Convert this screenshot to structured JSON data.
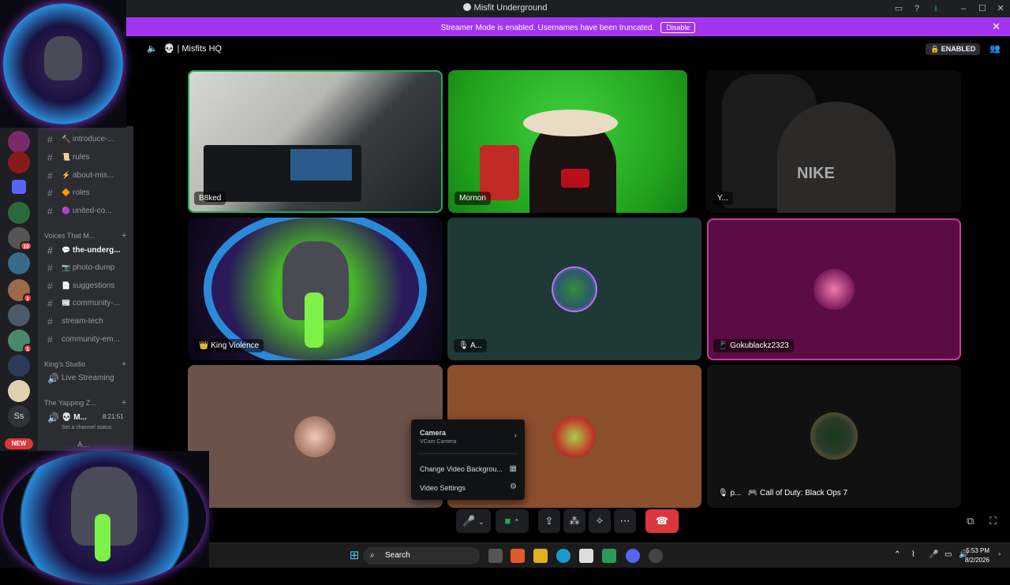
{
  "window": {
    "title": "Misfit Underground"
  },
  "banner": {
    "text": "Streamer Mode is enabled. Usernames have been truncated.",
    "button": "Disable"
  },
  "header": {
    "channel": "Misfits HQ",
    "status": "ENABLED"
  },
  "channels": [
    {
      "emoji": "🔨",
      "label": "introduce-..."
    },
    {
      "emoji": "📜",
      "label": "rules"
    },
    {
      "emoji": "⚡",
      "label": "about-mis..."
    },
    {
      "emoji": "🔶",
      "label": "roles"
    },
    {
      "emoji": "🟣",
      "label": "united-co..."
    }
  ],
  "category1": "Voices That M...",
  "channels2": [
    {
      "emoji": "💬",
      "label": "the-underg...",
      "active": true
    },
    {
      "emoji": "📷",
      "label": "photo-dump"
    },
    {
      "emoji": "📄",
      "label": "suggestions"
    },
    {
      "emoji": "📰",
      "label": "community-..."
    },
    {
      "emoji": "",
      "label": "stream-tech"
    },
    {
      "emoji": "",
      "label": "community-em..."
    }
  ],
  "category2": "King's Studio",
  "voice_channel": "Live Streaming",
  "category3": "The Yapping Z...",
  "voice_user": {
    "name": "M...",
    "time": "8:21:51",
    "status": "Set a channel status",
    "sub": "A..."
  },
  "server_initials": "Ss",
  "server_new": "NEW",
  "server_badges": [
    "10",
    "1",
    "1"
  ],
  "tiles": [
    {
      "name": "B8ked"
    },
    {
      "name": "Mornon"
    },
    {
      "name": "Y..."
    },
    {
      "name": "King Violence"
    },
    {
      "name": "A..."
    },
    {
      "name": "Gokublackz2323"
    },
    {
      "name": ""
    },
    {
      "name": ""
    },
    {
      "name": "p...",
      "game": "Call of Duty: Black Ops 7"
    }
  ],
  "menu": {
    "camera": "Camera",
    "camera_sub": "VCam Camera",
    "change_bg": "Change Video Backgrou...",
    "video_settings": "Video Settings"
  },
  "taskbar": {
    "search": "Search",
    "time": "5:53 PM",
    "date": "8/2/2026"
  },
  "colors": {
    "banner": "#a335f0",
    "speaking": "#23a55a",
    "leave": "#da373c"
  }
}
